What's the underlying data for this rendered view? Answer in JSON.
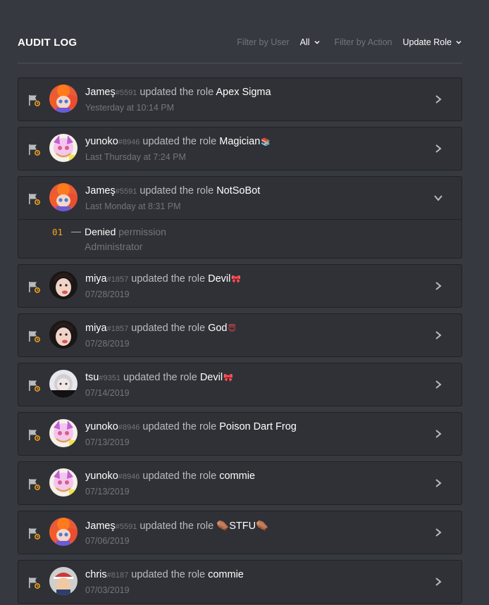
{
  "header": {
    "title": "AUDIT LOG",
    "filter_user_label": "Filter by User",
    "filter_user_value": "All",
    "filter_action_label": "Filter by Action",
    "filter_action_value": "Update Role"
  },
  "action_text": "updated the role",
  "entries": [
    {
      "user": "Jameş",
      "disc": "#5591",
      "role": "Apex Sigma",
      "emoji": "",
      "time": "Yesterday at 10:14 PM",
      "expanded": false
    },
    {
      "user": "yunoko",
      "disc": "#8946",
      "role": "Magician",
      "emoji": "📚",
      "time": "Last Thursday at 7:24 PM",
      "expanded": false
    },
    {
      "user": "Jameş",
      "disc": "#5591",
      "role": "NotSoBot",
      "emoji": "",
      "time": "Last Monday at 8:31 PM",
      "expanded": true
    },
    {
      "user": "miya",
      "disc": "#1857",
      "role": "Devil",
      "emoji": "🎀",
      "time": "07/28/2019",
      "expanded": false
    },
    {
      "user": "miya",
      "disc": "#1857",
      "role": "God",
      "emoji": "😇",
      "time": "07/28/2019",
      "expanded": false
    },
    {
      "user": "tsu",
      "disc": "#9351",
      "role": "Devil",
      "emoji": "🎀",
      "time": "07/14/2019",
      "expanded": false
    },
    {
      "user": "yunoko",
      "disc": "#8946",
      "role": "Poison Dart Frog",
      "emoji": "",
      "time": "07/13/2019",
      "expanded": false
    },
    {
      "user": "yunoko",
      "disc": "#8946",
      "role": "commie",
      "emoji": "",
      "time": "07/13/2019",
      "expanded": false
    },
    {
      "user": "Jameş",
      "disc": "#5591",
      "role": "⚰️STFU⚰️",
      "emoji": "",
      "time": "07/06/2019",
      "expanded": false
    },
    {
      "user": "chris",
      "disc": "#8187",
      "role": "commie",
      "emoji": "",
      "time": "07/03/2019",
      "expanded": false
    }
  ],
  "expanded_detail": {
    "number": "01",
    "dash": "—",
    "action": "Denied",
    "permission_word": "permission",
    "value": "Administrator"
  },
  "icons": {
    "flag": "flag-icon",
    "chevron_right": "chevron-right-icon",
    "chevron_down": "chevron-down-icon"
  },
  "colors": {
    "background": "#36393f",
    "entry_background": "#2f3136",
    "muted_text": "#72767d",
    "number_accent": "#faa61a"
  }
}
